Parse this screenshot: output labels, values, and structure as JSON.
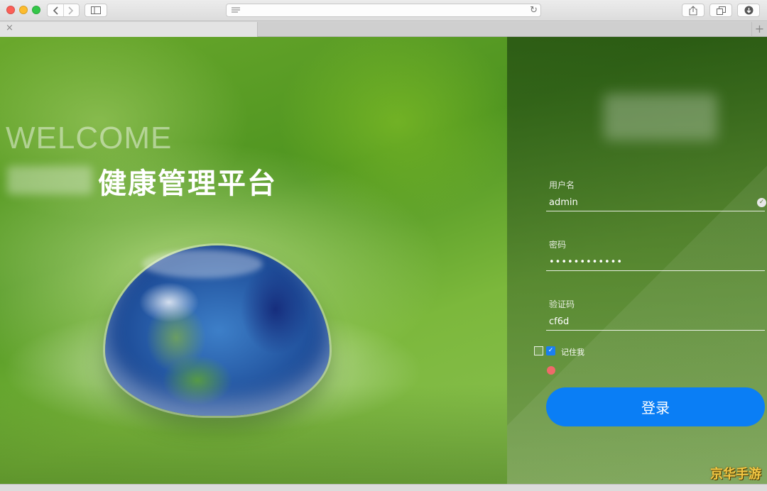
{
  "browser": {
    "tab_close_glyph": "×",
    "new_tab_glyph": "+",
    "reload_glyph": "↻"
  },
  "hero": {
    "welcome_text": "WELCOME",
    "platform_title": "健康管理平台"
  },
  "login": {
    "username_label": "用户名",
    "username_value": "admin",
    "password_label": "密码",
    "password_value": "••••••••••••",
    "captcha_label": "验证码",
    "captcha_value": "cf6d",
    "remember_label": "记住我",
    "remember_checked": true,
    "submit_label": "登录"
  },
  "watermark": {
    "text": "京华手游"
  },
  "colors": {
    "accent_blue": "#0a7ef5",
    "error_red": "#ef6a6a"
  }
}
